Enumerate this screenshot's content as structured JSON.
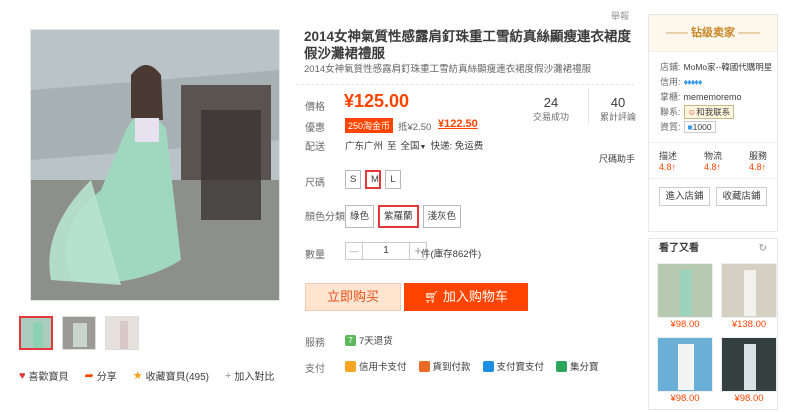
{
  "report_label": "舉報",
  "product": {
    "title": "2014女神氣質性感露肩釘珠重工雪紡真絲顯瘦連衣裙度假沙灘裙禮服",
    "subtitle": "2014女神氣質性感露肩釘珠重工雪紡真絲顯瘦連衣裙度假沙灘裙禮服"
  },
  "price": {
    "label": "價格",
    "value": "¥125.00",
    "promo_label": "優惠",
    "promo_tag": "250淘金币",
    "promo_discount": "抵¥2.50",
    "promo_price": "¥122.50",
    "ship_label": "配送",
    "ship_from": "广东广州",
    "ship_to_word": "至",
    "ship_to": "全国",
    "ship_note": "快递: 免运费",
    "size_helper": "尺碼助手"
  },
  "stats": [
    {
      "num": "24",
      "label": "交易成功"
    },
    {
      "num": "40",
      "label": "累計評論"
    }
  ],
  "size": {
    "label": "尺碼",
    "options": [
      "S",
      "M",
      "L"
    ],
    "selected": "M"
  },
  "color": {
    "label": "顏色分類",
    "options": [
      "綠色",
      "紫羅蘭",
      "淺灰色"
    ],
    "selected": "紫羅蘭"
  },
  "quantity": {
    "label": "數量",
    "minus": "—",
    "plus": "+",
    "value": "1",
    "stock": "件(庫存862件)"
  },
  "buttons": {
    "buy": "立即购买",
    "cart": "加入购物车"
  },
  "service": {
    "label": "服務",
    "icon_text": "7",
    "items": [
      "7天退货"
    ]
  },
  "payment": {
    "label": "支付",
    "items": [
      "信用卡支付",
      "貨到付款",
      "支付寶支付",
      "集分寶"
    ]
  },
  "gallery_actions": [
    {
      "icon": "heart-icon",
      "label": "喜歡寶貝"
    },
    {
      "icon": "share-icon",
      "label": "分享"
    },
    {
      "icon": "star-icon",
      "label": "收藏寶貝(495)"
    },
    {
      "icon": "plus-icon",
      "label": "加入對比"
    }
  ],
  "seller": {
    "badge": "钻级卖家",
    "shop_key": "店鋪:",
    "shop_name": "MoMo家--韓國代購明星",
    "credit_key": "信用:",
    "diamonds": 5,
    "keeper_key": "掌櫃:",
    "keeper": "mememoremo",
    "contact_key": "聯系:",
    "contact_btn": "和我联系",
    "qual_key": "資質:",
    "qual_val": "1000",
    "scores": [
      {
        "label": "描述",
        "val": "4.8"
      },
      {
        "label": "物流",
        "val": "4.8"
      },
      {
        "label": "服務",
        "val": "4.8"
      }
    ],
    "enter_btn": "進入店鋪",
    "fav_btn": "收藏店鋪"
  },
  "also_viewed": {
    "title": "看了又看",
    "items": [
      {
        "price": "¥98.00"
      },
      {
        "price": "¥138.00"
      },
      {
        "price": "¥98.00"
      },
      {
        "price": "¥98.00"
      }
    ]
  },
  "colors": {
    "accent": "#ff4400",
    "promo_red": "#e4393c",
    "seller_gold": "#c8882c"
  }
}
